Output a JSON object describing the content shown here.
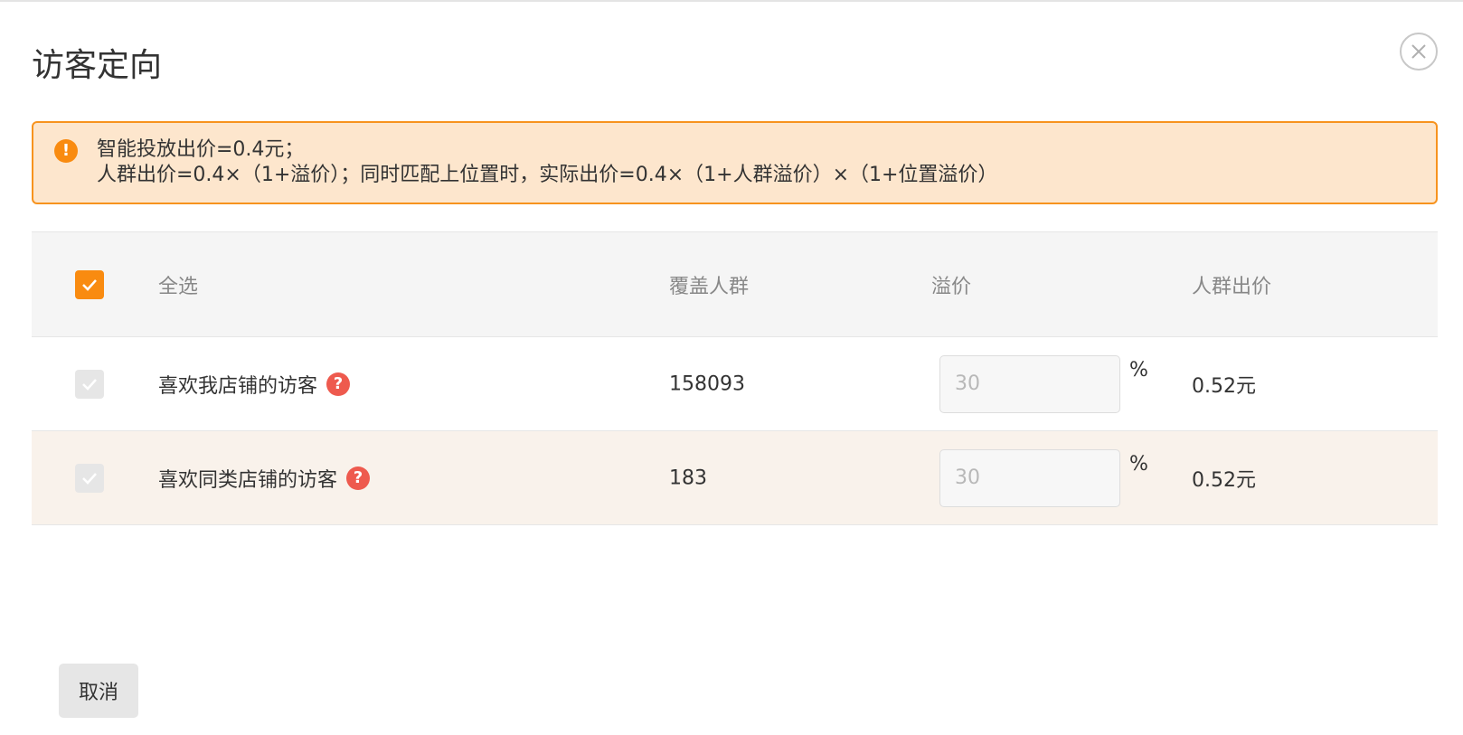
{
  "dialog": {
    "title": "访客定向",
    "close_icon": "close-icon"
  },
  "notice": {
    "icon": "warning-icon",
    "icon_glyph": "!",
    "line1": "智能投放出价=0.4元；",
    "line2": "人群出价=0.4×（1+溢价）；同时匹配上位置时，实际出价=0.4×（1+人群溢价）×（1+位置溢价）",
    "accent_color": "#f98b10",
    "background_color": "#fde6cd"
  },
  "table": {
    "header": {
      "select_all_checked": true,
      "select_all_label": "全选",
      "cover": "覆盖人群",
      "premium": "溢价",
      "bid": "人群出价"
    },
    "rows": [
      {
        "name": "喜欢我店铺的访客",
        "help_icon": "help-icon",
        "help_glyph": "?",
        "cover": "158093",
        "premium_value": "30",
        "premium_unit": "%",
        "bid": "0.52元",
        "checked": true,
        "disabled": true
      },
      {
        "name": "喜欢同类店铺的访客",
        "help_icon": "help-icon",
        "help_glyph": "?",
        "cover": "183",
        "premium_value": "30",
        "premium_unit": "%",
        "bid": "0.52元",
        "checked": true,
        "disabled": true
      }
    ]
  },
  "footer": {
    "cancel_label": "取消"
  }
}
